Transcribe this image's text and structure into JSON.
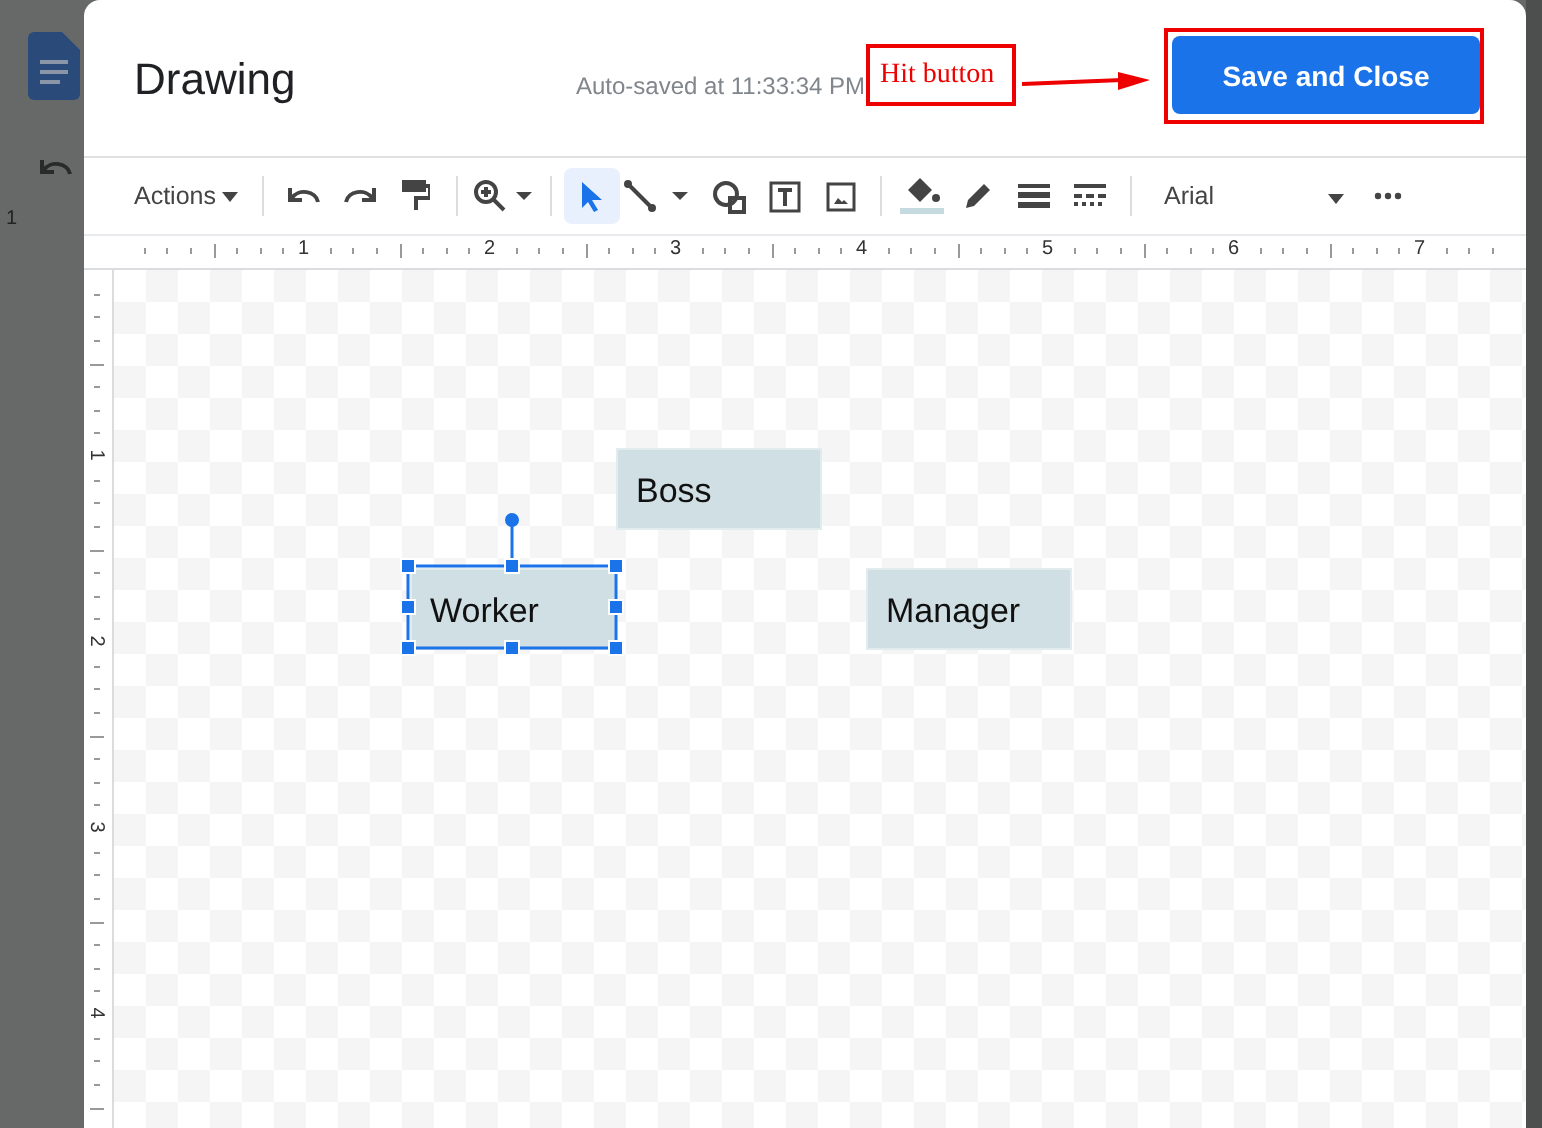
{
  "background": {
    "ruler_label": "1"
  },
  "dialog": {
    "title": "Drawing",
    "autosave": "Auto-saved at 11:33:34 PM",
    "save_button": "Save and Close"
  },
  "annotation": {
    "label": "Hit button"
  },
  "toolbar": [
    {
      "kind": "actions",
      "label": "Actions",
      "selected": false
    },
    {
      "kind": "sep"
    },
    {
      "kind": "undo",
      "selected": false
    },
    {
      "kind": "redo",
      "selected": false
    },
    {
      "kind": "paint-format",
      "selected": false
    },
    {
      "kind": "sep"
    },
    {
      "kind": "zoom",
      "selected": false
    },
    {
      "kind": "sep"
    },
    {
      "kind": "select",
      "selected": true
    },
    {
      "kind": "line",
      "selected": false
    },
    {
      "kind": "shape",
      "selected": false
    },
    {
      "kind": "text-box",
      "selected": false
    },
    {
      "kind": "image",
      "selected": false
    },
    {
      "kind": "sep"
    },
    {
      "kind": "fill",
      "selected": false
    },
    {
      "kind": "pen",
      "selected": false
    },
    {
      "kind": "line-weight",
      "selected": false
    },
    {
      "kind": "line-dash",
      "selected": false
    },
    {
      "kind": "sep"
    },
    {
      "kind": "font",
      "label": "Arial",
      "selected": false
    },
    {
      "kind": "more",
      "selected": false
    }
  ],
  "ruler": {
    "horizontal": [
      "1",
      "2",
      "3",
      "4",
      "5",
      "6",
      "7"
    ],
    "vertical": [
      "1",
      "2",
      "3",
      "4"
    ]
  },
  "shapes": [
    {
      "text": "Boss",
      "selected": false
    },
    {
      "text": "Worker",
      "selected": true
    },
    {
      "text": "Manager",
      "selected": false
    }
  ]
}
